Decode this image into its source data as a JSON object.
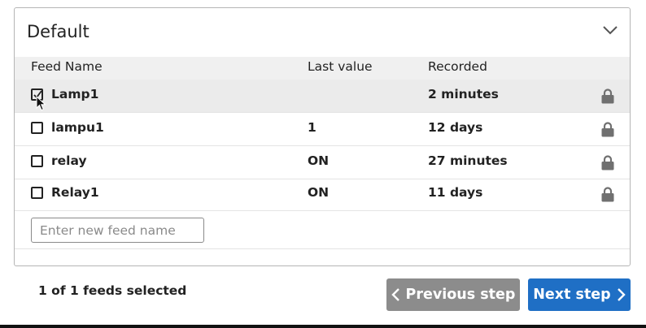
{
  "panel": {
    "title": "Default"
  },
  "table": {
    "headers": {
      "name": "Feed Name",
      "last_value": "Last value",
      "recorded": "Recorded"
    },
    "rows": [
      {
        "name": "Lamp1",
        "last_value": "",
        "recorded": "2 minutes",
        "checked": true
      },
      {
        "name": "lampu1",
        "last_value": "1",
        "recorded": "12 days",
        "checked": false
      },
      {
        "name": "relay",
        "last_value": "ON",
        "recorded": "27 minutes",
        "checked": false
      },
      {
        "name": "Relay1",
        "last_value": "ON",
        "recorded": "11 days",
        "checked": false
      }
    ]
  },
  "new_feed": {
    "placeholder": "Enter new feed name",
    "value": ""
  },
  "footer": {
    "status": "1 of 1 feeds selected",
    "prev_label": "Previous step",
    "next_label": "Next step"
  },
  "icons": {
    "collapse": "chevron-down-icon",
    "lock": "lock-icon",
    "prev": "chevron-left-icon",
    "next": "chevron-right-icon",
    "pointer": "mouse-pointer-icon"
  },
  "colors": {
    "next_button": "#1f6fc5",
    "prev_button": "#8c8c8c",
    "selected_row": "#ebebeb",
    "header_row": "#f0f0f0",
    "lock": "#707070"
  }
}
